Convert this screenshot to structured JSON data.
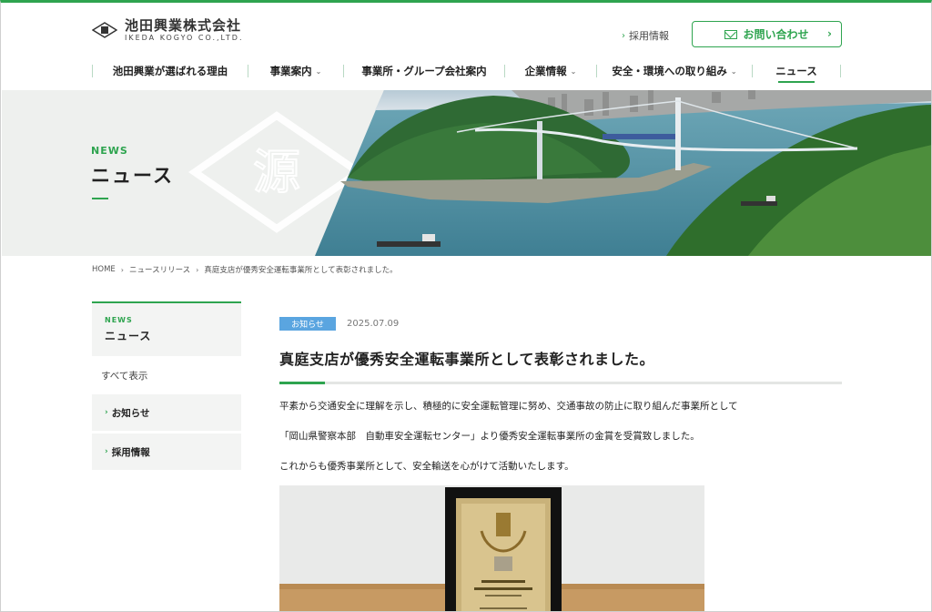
{
  "header": {
    "logo_jp": "池田興業株式会社",
    "logo_en": "IKEDA KOGYO CO.,LTD.",
    "recruit_link": "採用情報",
    "contact_label": "お問い合わせ"
  },
  "nav": {
    "items": [
      {
        "label": "池田興業が選ばれる理由"
      },
      {
        "label": "事業案内"
      },
      {
        "label": "事業所・グループ会社案内"
      },
      {
        "label": "企業情報"
      },
      {
        "label": "安全・環境への取り組み"
      },
      {
        "label": "ニュース"
      }
    ]
  },
  "hero": {
    "label_en": "NEWS",
    "title": "ニュース",
    "watermark_char": "源"
  },
  "breadcrumb": [
    "HOME",
    "ニュースリリース",
    "真庭支店が優秀安全運転事業所として表彰されました。"
  ],
  "sidebar": {
    "head_en": "NEWS",
    "head_jp": "ニュース",
    "all_label": "すべて表示",
    "items": [
      {
        "label": "お知らせ"
      },
      {
        "label": "採用情報"
      }
    ]
  },
  "article": {
    "tag": "お知らせ",
    "date": "2025.07.09",
    "title": "真庭支店が優秀安全運転事業所として表彰されました。",
    "paragraphs": [
      "平素から交通安全に理解を示し、積極的に安全運転管理に努め、交通事故の防止に取り組んだ事業所として",
      "「岡山県警察本部　自動車安全運転センター」より優秀安全運転事業所の金賞を受賞致しました。",
      "これからも優秀事業所として、安全輸送を心がけて活動いたします。"
    ]
  },
  "colors": {
    "accent": "#2ea44f",
    "tag_blue": "#5aa5e0",
    "panel_gray": "#f3f4f3"
  }
}
